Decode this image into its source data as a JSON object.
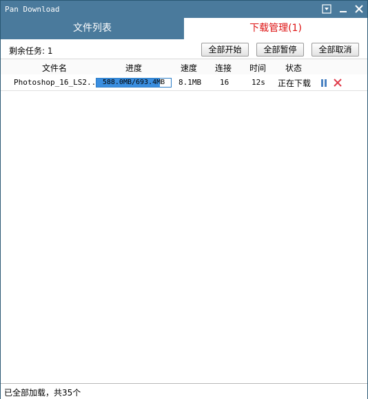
{
  "window": {
    "title": "Pan Download"
  },
  "tabs": [
    {
      "label": "文件列表",
      "active": false
    },
    {
      "label": "下载管理(1)",
      "active": true
    }
  ],
  "toolbar": {
    "remaining_label": "剩余任务: 1",
    "start_all": "全部开始",
    "pause_all": "全部暂停",
    "cancel_all": "全部取消"
  },
  "columns": {
    "filename": "文件名",
    "progress": "进度",
    "speed": "速度",
    "connections": "连接",
    "time": "时间",
    "status": "状态"
  },
  "downloads": [
    {
      "filename": "Photoshop_16_LS2...",
      "progress_text": "588.0MB/693.4MB",
      "progress_fraction": 0.848,
      "speed": "8.1MB",
      "connections": "16",
      "time": "12s",
      "status": "正在下载",
      "actions": [
        "pause-icon",
        "close-icon"
      ]
    }
  ],
  "statusbar": {
    "text": "已全部加载，共35个"
  },
  "colors": {
    "titlebar": "#4a7a9c",
    "active_tab_text": "#dd1111",
    "progress_fill": "#3a8ee0",
    "pause_icon": "#4a82c2",
    "cancel_icon": "#e03a4a"
  }
}
